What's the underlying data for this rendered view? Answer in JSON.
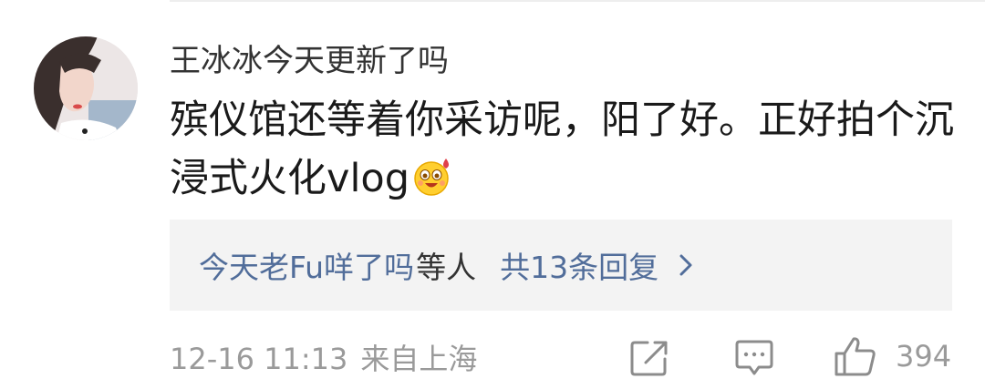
{
  "comment": {
    "username": "王冰冰今天更新了吗",
    "text": "殡仪馆还等着你采访呢，阳了好。正好拍个沉浸式火化vlog",
    "emoji": "emoji-sweat-laugh"
  },
  "reply_preview": {
    "user": "今天老Fu咩了吗",
    "suffix": "等人",
    "count_text": "共13条回复"
  },
  "meta": {
    "timestamp": "12-16 11:13",
    "location": "来自上海"
  },
  "actions": {
    "like_count": "394"
  },
  "colors": {
    "link": "#516d9a",
    "muted": "#9a9a9a",
    "reply_bg": "#f3f3f3"
  }
}
